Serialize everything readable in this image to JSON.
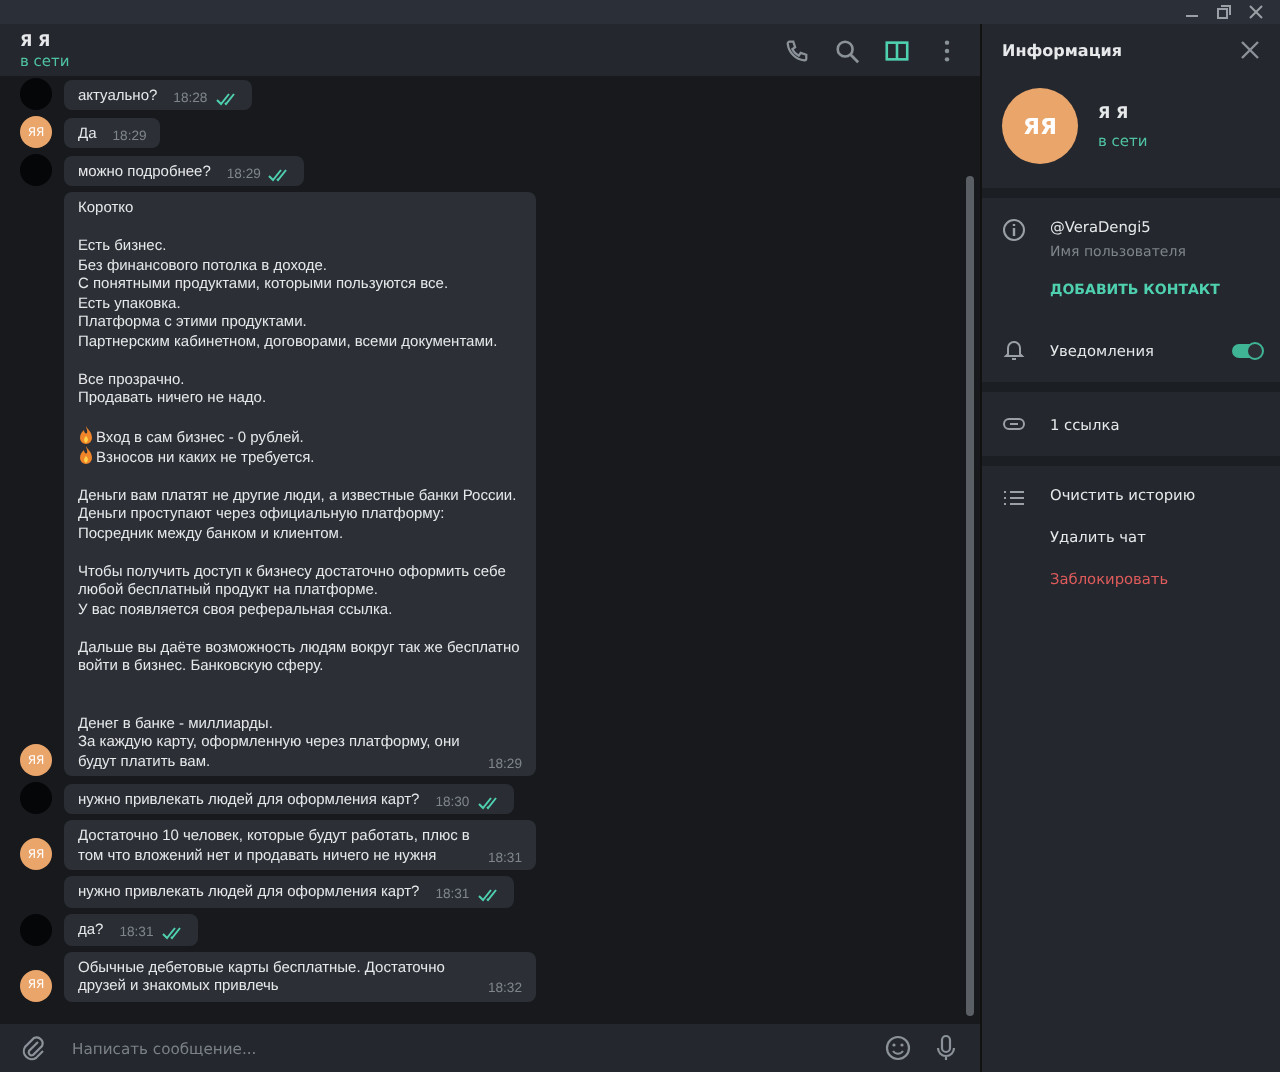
{
  "chat": {
    "title": "Я Я",
    "status": "в сети"
  },
  "header_icons": [
    {
      "kind": "phone",
      "selected": false
    },
    {
      "kind": "search",
      "selected": false
    },
    {
      "kind": "panel",
      "selected": true
    },
    {
      "kind": "more",
      "selected": false
    }
  ],
  "messages": [
    {
      "kind": "outgoing",
      "avatar": true,
      "paragraphs": [
        {
          "kind": "plain",
          "lines": [
            {
              "kind": "plain",
              "text": "актуально?"
            }
          ]
        }
      ],
      "time": "18:28",
      "read": true
    },
    {
      "kind": "incoming",
      "avatar": true,
      "avatar_text": "ЯЯ",
      "paragraphs": [
        {
          "kind": "plain",
          "lines": [
            {
              "kind": "plain",
              "text": "Да"
            }
          ]
        }
      ],
      "time": "18:29",
      "read": false
    },
    {
      "kind": "outgoing",
      "avatar": true,
      "paragraphs": [
        {
          "kind": "plain",
          "lines": [
            {
              "kind": "plain",
              "text": "можно подробнее?"
            }
          ]
        }
      ],
      "time": "18:29",
      "read": true
    },
    {
      "kind": "incoming",
      "avatar": true,
      "avatar_text": "ЯЯ",
      "paragraphs": [
        {
          "kind": "plain",
          "lines": [
            {
              "kind": "plain",
              "text": "Коротко"
            }
          ]
        },
        {
          "kind": "plain",
          "lines": [
            {
              "kind": "plain",
              "text": "Есть бизнес."
            },
            {
              "kind": "plain",
              "text": "Без финансового потолка в доходе."
            },
            {
              "kind": "plain",
              "text": "С понятными продуктами, которыми пользуются все."
            },
            {
              "kind": "plain",
              "text": "Есть упаковка."
            },
            {
              "kind": "plain",
              "text": "Платформа с этими продуктами."
            },
            {
              "kind": "plain",
              "text": "Партнерским кабинетном, договорами, всеми документами."
            }
          ]
        },
        {
          "kind": "plain",
          "lines": [
            {
              "kind": "plain",
              "text": "Все прозрачно."
            },
            {
              "kind": "plain",
              "text": "Продавать ничего не надо."
            }
          ]
        },
        {
          "kind": "plain",
          "lines": [
            {
              "kind": "fire",
              "text": "Вход в сам бизнес - 0 рублей."
            },
            {
              "kind": "fire",
              "text": "Взносов ни каких не требуется."
            }
          ]
        },
        {
          "kind": "plain",
          "lines": [
            {
              "kind": "plain",
              "text": "Деньги вам платят не другие люди, а известные банки России."
            },
            {
              "kind": "plain",
              "text": "Деньги проступают через официальную платформу:"
            },
            {
              "kind": "plain",
              "text": "Посредник между банком и клиентом."
            }
          ]
        },
        {
          "kind": "plain",
          "lines": [
            {
              "kind": "plain",
              "text": "Чтобы получить доступ к бизнесу достаточно оформить себе любой бесплатный продукт на платформе."
            },
            {
              "kind": "plain",
              "text": "У вас появляется своя реферальная ссылка."
            }
          ]
        },
        {
          "kind": "plain",
          "lines": [
            {
              "kind": "plain",
              "text": "Дальше вы даёте возможность людям вокруг так же бесплатно войти в  бизнес. Банковскую сферу."
            }
          ]
        },
        {
          "kind": "spaced",
          "lines": [
            {
              "kind": "plain",
              "text": "Денег в банке - миллиарды."
            },
            {
              "kind": "plain",
              "text": "За каждую карту, оформленную через платформу, они будут платить вам."
            }
          ]
        }
      ],
      "time": "18:29",
      "read": false
    },
    {
      "kind": "outgoing",
      "avatar": true,
      "paragraphs": [
        {
          "kind": "plain",
          "lines": [
            {
              "kind": "plain",
              "text": "нужно привлекать людей для оформления карт?"
            }
          ]
        }
      ],
      "time": "18:30",
      "read": true
    },
    {
      "kind": "incoming",
      "avatar": true,
      "avatar_text": "ЯЯ",
      "paragraphs": [
        {
          "kind": "plain",
          "lines": [
            {
              "kind": "plain",
              "text": "Достаточно 10 человек, которые будут работать, плюс в том что вложений нет и продавать ничего не нужня"
            }
          ]
        }
      ],
      "time": "18:31",
      "read": false
    },
    {
      "kind": "outgoing",
      "avatar": false,
      "paragraphs": [
        {
          "kind": "plain",
          "lines": [
            {
              "kind": "plain",
              "text": "нужно привлекать людей для оформления карт?"
            }
          ]
        }
      ],
      "time": "18:31",
      "read": true
    },
    {
      "kind": "outgoing",
      "avatar": true,
      "paragraphs": [
        {
          "kind": "plain",
          "lines": [
            {
              "kind": "plain",
              "text": "да?"
            }
          ]
        }
      ],
      "time": "18:31",
      "read": true
    },
    {
      "kind": "incoming",
      "avatar": true,
      "avatar_text": "ЯЯ",
      "paragraphs": [
        {
          "kind": "plain",
          "lines": [
            {
              "kind": "plain",
              "text": "Обычные дебетовые карты бесплатные. Достаточно друзей и знакомых привлечь"
            }
          ]
        }
      ],
      "time": "18:32",
      "read": false
    }
  ],
  "composer": {
    "placeholder": "Написать сообщение..."
  },
  "info_panel": {
    "title": "Информация",
    "avatar_text": "ЯЯ",
    "name": "Я Я",
    "status": "в сети",
    "username": "@VeraDengi5",
    "username_label": "Имя пользователя",
    "add_contact": "ДОБАВИТЬ КОНТАКТ",
    "notifications": {
      "label": "Уведомления",
      "on": true
    },
    "links": "1 ссылка",
    "actions": [
      {
        "label": "Очистить историю",
        "kind": "normal"
      },
      {
        "label": "Удалить чат",
        "kind": "normal"
      },
      {
        "label": "Заблокировать",
        "kind": "danger"
      }
    ]
  }
}
